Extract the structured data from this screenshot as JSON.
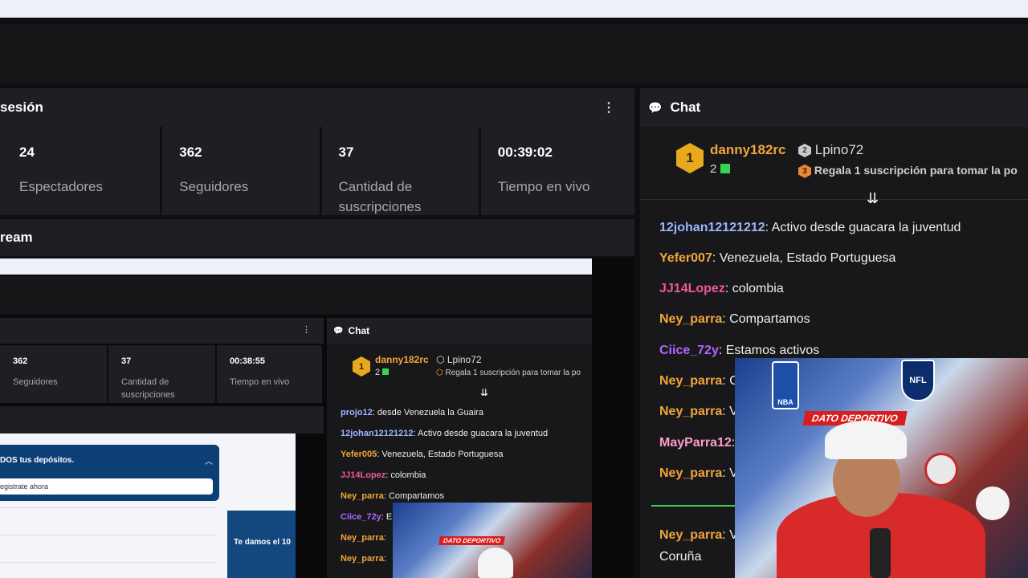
{
  "session": {
    "title": "sesión",
    "menu_icon": "kebab-icon"
  },
  "stats": [
    {
      "value": "24",
      "label": "Espectadores"
    },
    {
      "value": "362",
      "label": "Seguidores"
    },
    {
      "value": "37",
      "label": "Cantidad de suscripciones"
    },
    {
      "value": "00:39:02",
      "label": "Tiempo en vivo"
    }
  ],
  "stream": {
    "title": "ream"
  },
  "chat": {
    "title": "Chat",
    "leaderboard": {
      "first": {
        "rank": "1",
        "name": "danny182rc",
        "count": "2"
      },
      "second": {
        "rank": "2",
        "name": "Lpino72"
      },
      "third": {
        "rank": "3",
        "text": "Regala 1 suscripción para tomar la po"
      }
    },
    "messages": [
      {
        "user": "12johan12121212",
        "text": ": Activo desde guacara la juventud",
        "color": "#9bb6ff"
      },
      {
        "user": "Yefer007",
        "text": ": Venezuela, Estado Portuguesa",
        "color": "#f2a53a"
      },
      {
        "user": "JJ14Lopez",
        "text": ": colombia",
        "color": "#f0569a"
      },
      {
        "user": "Ney_parra",
        "text": ": Compartamos",
        "color": "#f2a53a"
      },
      {
        "user": "Ciice_72y",
        "text": ": Estamos activos",
        "color": "#b265ff"
      },
      {
        "user": "Ney_parra",
        "text": ": C",
        "color": "#f2a53a"
      },
      {
        "user": "Ney_parra",
        "text": ": V",
        "color": "#f2a53a"
      },
      {
        "user": "MayParra12",
        "text": ":",
        "color": "#ff9bd0"
      },
      {
        "user": "Ney_parra",
        "text": ": V",
        "color": "#f2a53a"
      },
      {
        "user": "Ney_parra",
        "text": ": V",
        "color": "#f2a53a"
      }
    ],
    "last_line": "Coruña"
  },
  "nested": {
    "stats": [
      {
        "value": "362",
        "label": "Seguidores"
      },
      {
        "value": "37",
        "label": "Cantidad de suscripciones"
      },
      {
        "value": "00:38:55",
        "label": "Tiempo en vivo"
      }
    ],
    "chat_title": "Chat",
    "leader_first": "danny182rc",
    "leader_first_count": "2",
    "leader_second": "Lpino72",
    "leader_third": "Regala 1 suscripción para tomar la po",
    "messages": [
      {
        "user": "projo12",
        "text": ": desde Venezuela la Guaira",
        "color": "#9bb6ff"
      },
      {
        "user": "12johan12121212",
        "text": ": Activo desde guacara la juventud",
        "color": "#9bb6ff"
      },
      {
        "user": "Yefer005",
        "text": ": Venezuela, Estado Portuguesa",
        "color": "#f2a53a"
      },
      {
        "user": "JJ14Lopez",
        "text": ": colombia",
        "color": "#f0569a"
      },
      {
        "user": "Ney_parra",
        "text": ": Compartamos",
        "color": "#f2a53a"
      },
      {
        "user": "Ciice_72y",
        "text": ": E",
        "color": "#b265ff"
      },
      {
        "user": "Ney_parra",
        "text": ": ",
        "color": "#f2a53a"
      },
      {
        "user": "Ney_parra",
        "text": ": ",
        "color": "#f2a53a"
      }
    ],
    "web_banner": "DOS tus depósitos.",
    "web_input": "egistrate ahora",
    "web_ad": "Te damos el 10"
  },
  "webcam": {
    "overlay_text": "DATO DEPORTIVO",
    "league_tags": [
      "NBA",
      "NFL"
    ]
  }
}
